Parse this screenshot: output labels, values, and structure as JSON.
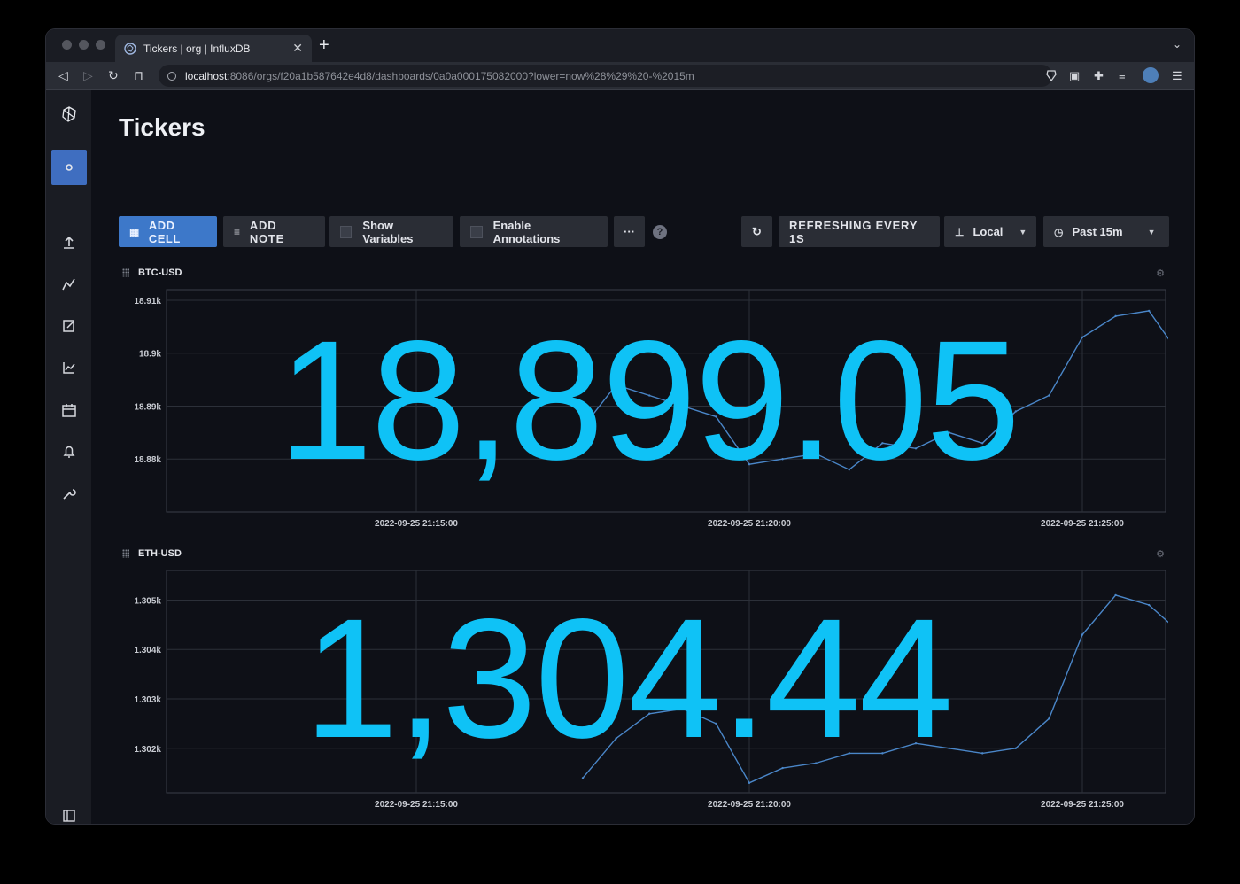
{
  "browser": {
    "tab_title": "Tickers | org | InfluxDB",
    "url_host": "localhost",
    "url_path": ":8086/orgs/f20a1b587642e4d8/dashboards/0a0a000175082000?lower=now%28%29%20-%2015m"
  },
  "page": {
    "title": "Tickers"
  },
  "toolbar": {
    "add_cell": "ADD CELL",
    "add_note": "ADD NOTE",
    "show_variables": "Show Variables",
    "enable_annotations": "Enable Annotations",
    "more": "···",
    "help": "?",
    "refresh_interval": "REFRESHING EVERY 1S",
    "timezone": "Local",
    "time_range": "Past 15m"
  },
  "colors": {
    "accent": "#3d78c9",
    "value": "#0fc2f6",
    "line": "#4a86c8"
  },
  "cells": [
    {
      "name": "BTC-USD",
      "value": "18,899.05",
      "y_ticks": [
        "18.91k",
        "18.9k",
        "18.89k",
        "18.88k"
      ],
      "x_ticks": [
        "2022-09-25 21:15:00",
        "2022-09-25 21:20:00",
        "2022-09-25 21:25:00"
      ]
    },
    {
      "name": "ETH-USD",
      "value": "1,304.44",
      "y_ticks": [
        "1.305k",
        "1.304k",
        "1.303k",
        "1.302k"
      ],
      "x_ticks": [
        "2022-09-25 21:15:00",
        "2022-09-25 21:20:00",
        "2022-09-25 21:25:00"
      ]
    }
  ],
  "chart_data": [
    {
      "type": "line",
      "title": "BTC-USD",
      "ylim": [
        18870,
        18912
      ],
      "yticks": [
        18910,
        18900,
        18890,
        18880
      ],
      "x": [
        "21:17:30",
        "21:18:00",
        "21:18:30",
        "21:19:00",
        "21:19:30",
        "21:20:00",
        "21:20:30",
        "21:21:00",
        "21:21:30",
        "21:22:00",
        "21:22:30",
        "21:23:00",
        "21:23:30",
        "21:24:00",
        "21:24:30",
        "21:25:00",
        "21:25:30",
        "21:26:00",
        "21:26:30"
      ],
      "series": [
        {
          "values": [
            18886,
            18894,
            18892,
            18890,
            18888,
            18879,
            18880,
            18881,
            18878,
            18883,
            18882,
            18885,
            18883,
            18889,
            18892,
            18903,
            18907,
            18908,
            18899
          ]
        }
      ]
    },
    {
      "type": "line",
      "title": "ETH-USD",
      "ylim": [
        1301.1,
        1305.6
      ],
      "yticks": [
        1305,
        1304,
        1303,
        1302
      ],
      "x": [
        "21:17:30",
        "21:18:00",
        "21:18:30",
        "21:19:00",
        "21:19:30",
        "21:20:00",
        "21:20:30",
        "21:21:00",
        "21:21:30",
        "21:22:00",
        "21:22:30",
        "21:23:00",
        "21:23:30",
        "21:24:00",
        "21:24:30",
        "21:25:00",
        "21:25:30",
        "21:26:00",
        "21:26:30"
      ],
      "series": [
        {
          "values": [
            1301.4,
            1302.2,
            1302.7,
            1302.8,
            1302.5,
            1301.3,
            1301.6,
            1301.7,
            1301.9,
            1301.9,
            1302.1,
            1302.0,
            1301.9,
            1302.0,
            1302.6,
            1304.3,
            1305.1,
            1304.9,
            1304.3
          ]
        }
      ]
    }
  ]
}
